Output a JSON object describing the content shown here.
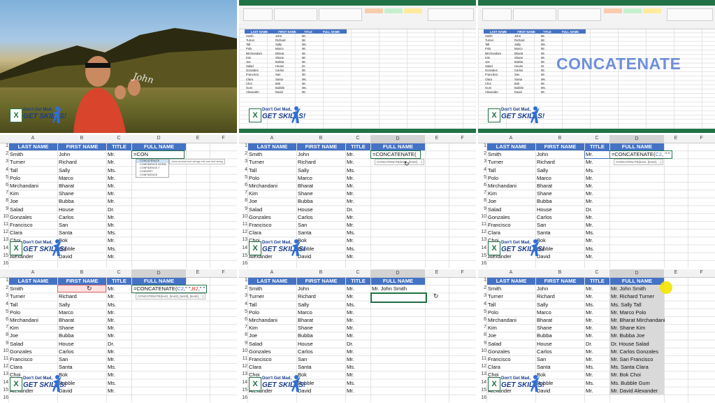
{
  "title_text": "CONCATENATE",
  "video": {
    "written_word": "John"
  },
  "logo": {
    "line1": "Don't Get Mad,",
    "line2": "GET SKILLS!",
    "excel_letter": "X"
  },
  "columns": [
    "A",
    "B",
    "C",
    "D",
    "E",
    "F"
  ],
  "headers": {
    "last": "LAST NAME",
    "first": "FIRST NAME",
    "title": "TITLE",
    "full": "FULL NAME"
  },
  "rows": [
    {
      "last": "Smith",
      "first": "John",
      "title": "Mr."
    },
    {
      "last": "Turner",
      "first": "Richard",
      "title": "Mr."
    },
    {
      "last": "Tall",
      "first": "Sally",
      "title": "Ms."
    },
    {
      "last": "Polo",
      "first": "Marco",
      "title": "Mr."
    },
    {
      "last": "Mirchandani",
      "first": "Bharat",
      "title": "Mr."
    },
    {
      "last": "Kim",
      "first": "Shane",
      "title": "Mr."
    },
    {
      "last": "Joe",
      "first": "Bubba",
      "title": "Mr."
    },
    {
      "last": "Salad",
      "first": "House",
      "title": "Dr."
    },
    {
      "last": "Gonzales",
      "first": "Carlos",
      "title": "Mr."
    },
    {
      "last": "Francisco",
      "first": "San",
      "title": "Mr."
    },
    {
      "last": "Clara",
      "first": "Santa",
      "title": "Ms."
    },
    {
      "last": "Choi",
      "first": "Bok",
      "title": "Mr."
    },
    {
      "last": "Gum",
      "first": "Bubble",
      "title": "Ms."
    },
    {
      "last": "Alexander",
      "first": "David",
      "title": "Mr."
    }
  ],
  "row_numbers": [
    "1",
    "2",
    "3",
    "4",
    "5",
    "6",
    "7",
    "8",
    "9",
    "10",
    "11",
    "12",
    "13",
    "14",
    "15",
    "16"
  ],
  "full_names": [
    "Mr. John Smith",
    "Mr. Richard Turner",
    "Ms. Sally Tall",
    "Mr. Marco Polo",
    "Mr. Bharat Mirchandani",
    "Mr. Shane Kim",
    "Mr. Bubba Joe",
    "Dr. House Salad",
    "Mr. Carlos Gonzales",
    "Mr. San Francisco",
    "Ms. Santa Clara",
    "Mr. Bok Choi",
    "Ms. Bubble Gum",
    "Mr. David Alexander"
  ],
  "panels": {
    "p4": {
      "formula": "=CON",
      "autocomplete": [
        "CONCATENATE",
        "CONFIDENCE.NORM",
        "CONFIDENCE.T",
        "CONVERT",
        "CONFIDENCE"
      ],
      "autocomplete_desc": "Joins several text strings into one text string"
    },
    "p5": {
      "formula": "=CONCATENATE(",
      "tip": "CONCATENATE(text1, [text2], ...)"
    },
    "p6": {
      "formula_a": "=CONCATENATE(",
      "formula_ref": "C2",
      "formula_b": ", \" \"",
      "tip": "CONCATENATE(text1, [text2], ...)"
    },
    "p7": {
      "formula_a": "=CONCATENATE(",
      "formula_ref": "C2",
      "formula_b": ",\" \",",
      "formula_ref2": "B2",
      "formula_c": ",\" \"",
      "tip": "CONCATENATE(text1, [text2], [text3], [text4], ...)"
    },
    "p8": {
      "result": "Mr. John Smith"
    }
  },
  "colors": {
    "excel_green": "#217346",
    "header_blue": "#4472c4",
    "title_blue": "#6f8fd8",
    "highlight_yellow": "#f5e400"
  }
}
